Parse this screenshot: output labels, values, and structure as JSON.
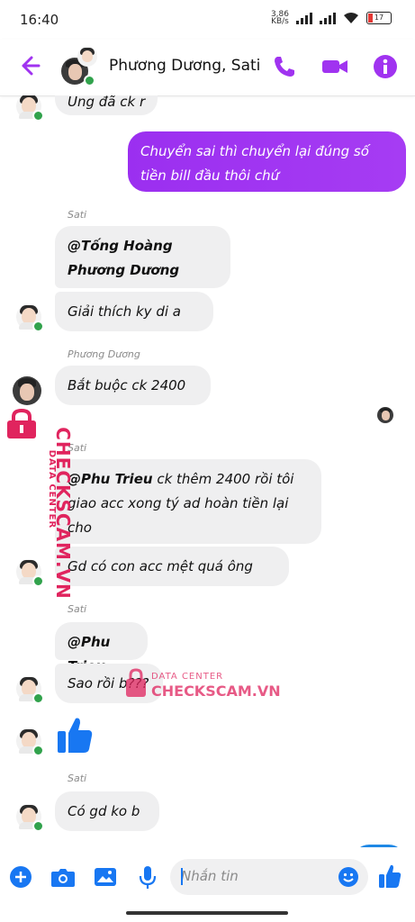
{
  "status": {
    "time": "16:40",
    "net_speed": "3,86\nKB/s",
    "battery": "17"
  },
  "header": {
    "title": "Phương Dương, Sati"
  },
  "messages": {
    "m0": "Ủng đã ck r",
    "sent1": "Chuyển sai thì chuyển lại đúng số tiền bill đầu thôi chứ",
    "name_sati_1": "Sati",
    "m1_mention": "@Tống Hoàng Phương Dương",
    "m2": "Giải thích ky di a",
    "name_phuong": "Phương Dương",
    "m3": "Bắt buộc ck 2400",
    "name_sati_2": "Sati",
    "m4_mention": "@Phu Trieu",
    "m4_text": " ck thêm 2400 rồi tôi giao acc xong tý ad hoàn tiền lại cho",
    "m5": "Gd có con acc mệt quá ông",
    "name_sati_3": "Sati",
    "m6_mention": "@Phu Trieu",
    "m7": "Sao rồi b???",
    "name_sati_4": "Sati",
    "m8": "Có gd ko b"
  },
  "watermark": {
    "label": "DATA CENTER",
    "brand": "CHECKSCAM.VN"
  },
  "composer": {
    "placeholder": "Nhắn tin"
  },
  "colors": {
    "accent": "#a033f0",
    "messenger_blue": "#1877f2",
    "online": "#31a24c",
    "watermark": "#e0245e"
  }
}
